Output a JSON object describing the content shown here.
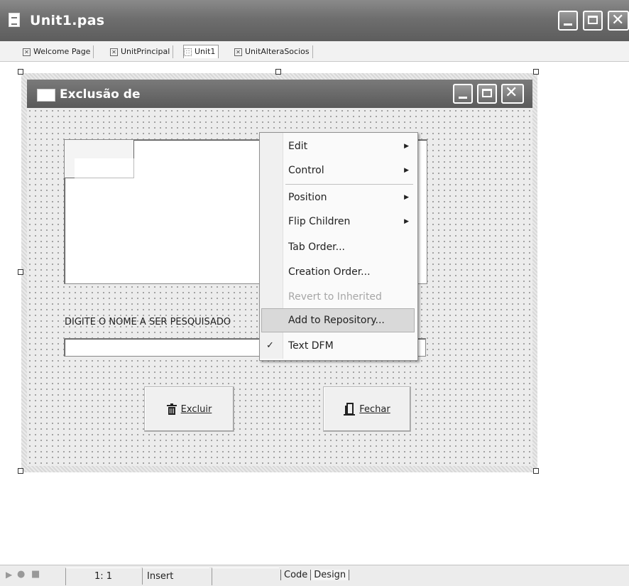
{
  "window": {
    "title": "Unit1.pas"
  },
  "tabs": [
    {
      "label": "Welcome Page"
    },
    {
      "label": "UnitPrincipal"
    },
    {
      "label": "Unit1"
    },
    {
      "label": "UnitAlteraSocios"
    }
  ],
  "form": {
    "title": "Exclusão de",
    "search_label": "DIGITE O NOME A SER PESQUISADO",
    "search_value": "",
    "excluir_label": "Excluir",
    "fechar_label": "Fechar"
  },
  "context_menu": {
    "items": [
      {
        "label": "Edit",
        "submenu": true
      },
      {
        "label": "Control",
        "submenu": true
      },
      {
        "label": "Position",
        "submenu": true
      },
      {
        "label": "Flip Children",
        "submenu": true
      },
      {
        "label": "Tab Order..."
      },
      {
        "label": "Creation Order..."
      },
      {
        "label": "Revert to Inherited",
        "disabled": true
      },
      {
        "label": "Add to Repository...",
        "highlighted": true
      },
      {
        "label": "Text DFM",
        "checked": true
      }
    ]
  },
  "statusbar": {
    "position": "1:   1",
    "mode": "Insert",
    "tab_code": "Code",
    "tab_design": "Design"
  },
  "colors": {
    "titlebar": "#6e6e6e",
    "menu_highlight": "#d9d9d9",
    "form_body": "#ececec"
  }
}
